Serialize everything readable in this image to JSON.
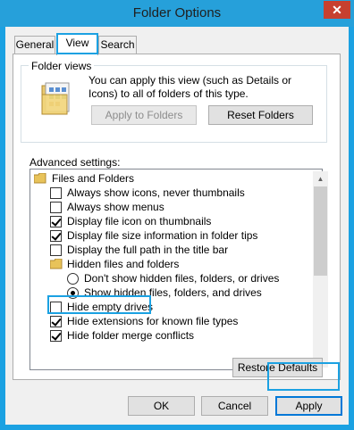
{
  "window": {
    "title": "Folder Options",
    "close_glyph": "✕"
  },
  "tabs": [
    {
      "label": "General",
      "active": false
    },
    {
      "label": "View",
      "active": true
    },
    {
      "label": "Search",
      "active": false
    }
  ],
  "folder_views": {
    "group_label": "Folder views",
    "description": "You can apply this view (such as Details or Icons) to all of folders of this type.",
    "apply_button": "Apply to Folders",
    "reset_button": "Reset Folders"
  },
  "advanced": {
    "label": "Advanced settings:",
    "items": [
      {
        "type": "folder",
        "label": "Files and Folders"
      },
      {
        "type": "checkbox",
        "checked": false,
        "label": "Always show icons, never thumbnails"
      },
      {
        "type": "checkbox",
        "checked": false,
        "label": "Always show menus"
      },
      {
        "type": "checkbox",
        "checked": true,
        "label": "Display file icon on thumbnails"
      },
      {
        "type": "checkbox",
        "checked": true,
        "label": "Display file size information in folder tips"
      },
      {
        "type": "checkbox",
        "checked": false,
        "label": "Display the full path in the title bar"
      },
      {
        "type": "folder",
        "label": "Hidden files and folders"
      },
      {
        "type": "radio",
        "checked": false,
        "label": "Don't show hidden files, folders, or drives"
      },
      {
        "type": "radio",
        "checked": true,
        "label": "Show hidden files, folders, and drives"
      },
      {
        "type": "checkbox",
        "checked": false,
        "label": "Hide empty drives",
        "highlighted": true
      },
      {
        "type": "checkbox",
        "checked": true,
        "label": "Hide extensions for known file types"
      },
      {
        "type": "checkbox",
        "checked": true,
        "label": "Hide folder merge conflicts"
      }
    ],
    "restore_button": "Restore Defaults"
  },
  "footer": {
    "ok": "OK",
    "cancel": "Cancel",
    "apply": "Apply"
  },
  "colors": {
    "highlight": "#1ba1e2",
    "title_bar": "#26a0da",
    "close": "#c7402f"
  },
  "icons": {
    "up_arrow": "▲",
    "down_arrow": "▼"
  }
}
